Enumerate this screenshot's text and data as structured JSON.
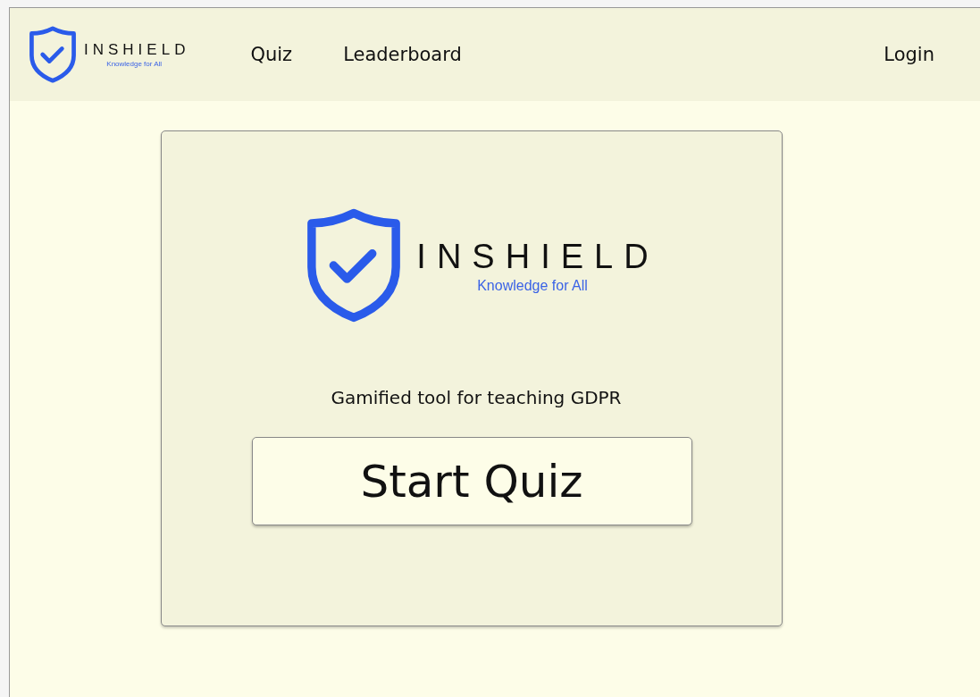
{
  "header": {
    "logo": {
      "name": "INSHIELD",
      "tagline": "Knowledge for All"
    },
    "nav": [
      {
        "label": "Quiz"
      },
      {
        "label": "Leaderboard"
      }
    ],
    "login": "Login"
  },
  "card": {
    "logo": {
      "name": "INSHIELD",
      "tagline": "Knowledge for All"
    },
    "subtitle": "Gamified tool for teaching GDPR",
    "button": "Start Quiz"
  }
}
